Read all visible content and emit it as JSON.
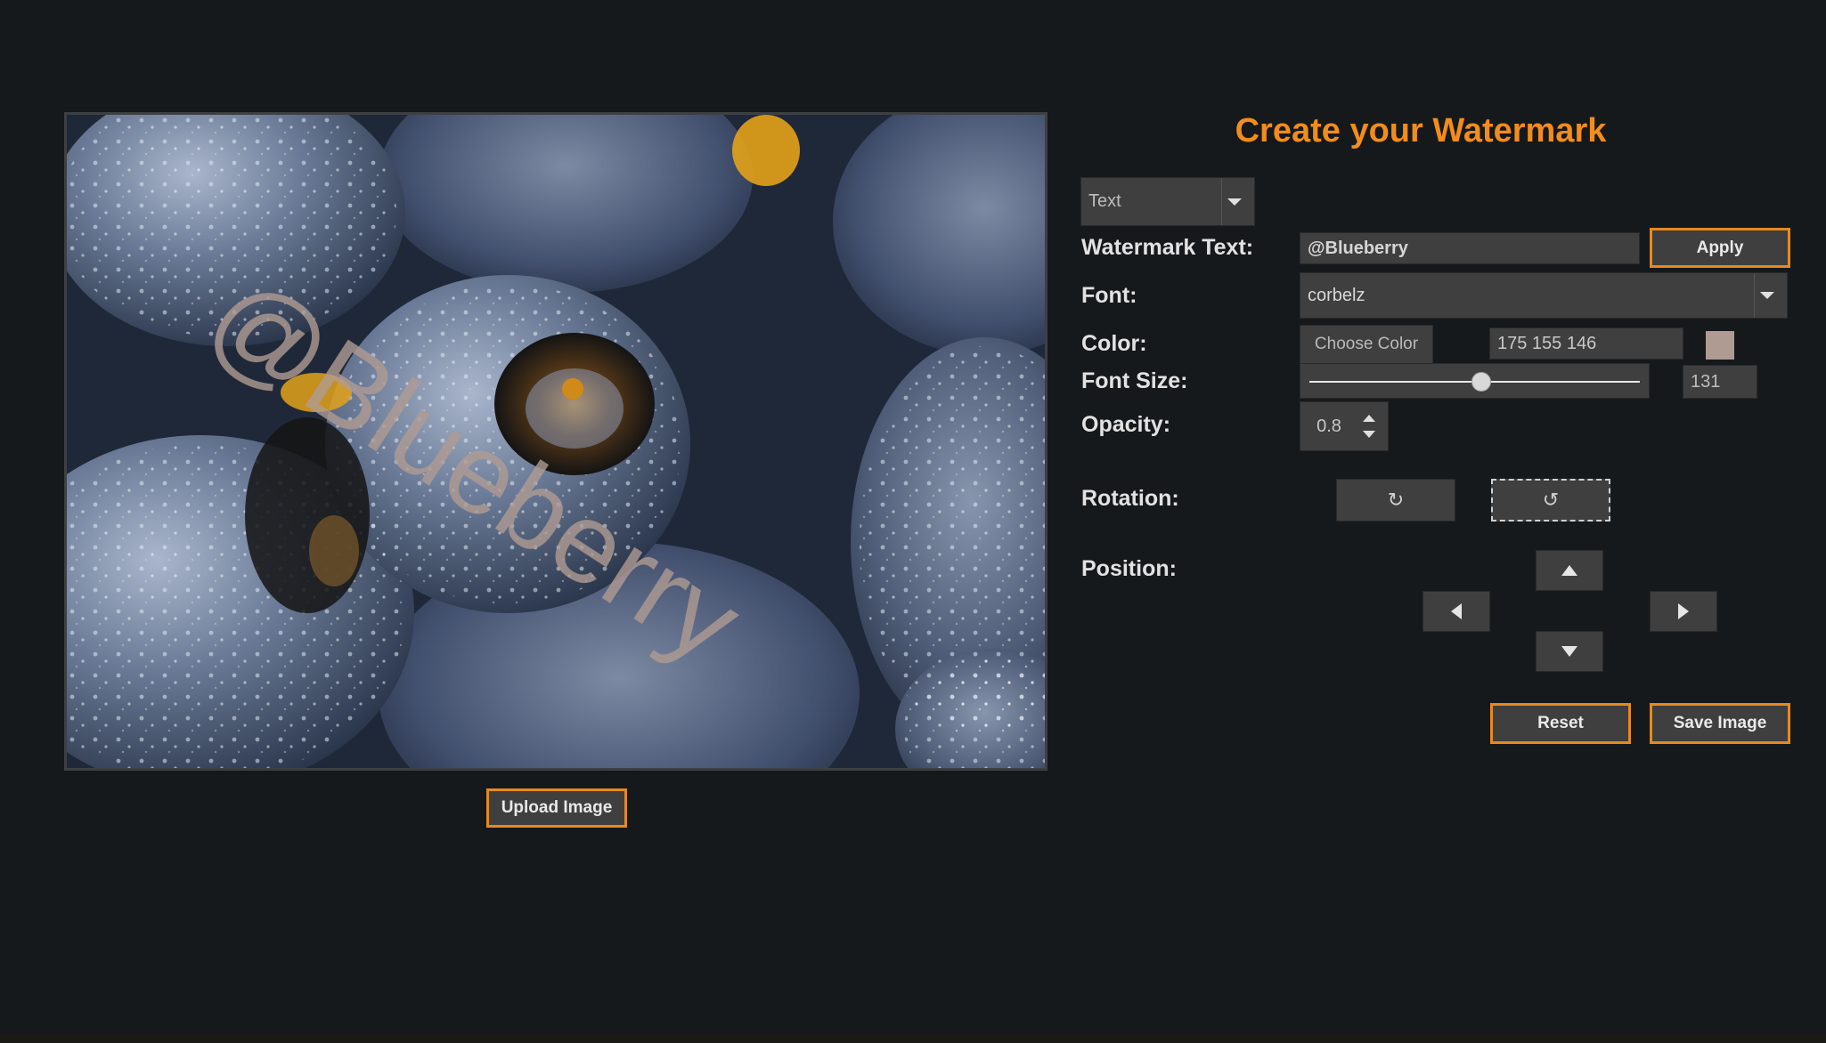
{
  "title": "Create your Watermark",
  "watermark_type": {
    "selected": "Text"
  },
  "labels": {
    "watermark_text": "Watermark Text:",
    "font": "Font:",
    "color": "Color:",
    "font_size": "Font Size:",
    "opacity": "Opacity:",
    "rotation": "Rotation:",
    "position": "Position:"
  },
  "watermark_text": {
    "value": "@Blueberry"
  },
  "font": {
    "selected": "corbelz"
  },
  "color": {
    "rgb_text": "175 155 146",
    "swatch_hex": "#af9b92"
  },
  "font_size": {
    "value": "131",
    "slider_fraction": 0.52
  },
  "opacity": {
    "value": "0.8"
  },
  "buttons": {
    "apply": "Apply",
    "choose_color": "Choose Color",
    "reset": "Reset",
    "save_image": "Save Image",
    "upload_image": "Upload Image"
  },
  "rotation_icons": {
    "clockwise": "↻",
    "counterclockwise": "↺"
  },
  "preview": {
    "overlay_text": "@Blueberry",
    "overlay_color": "#af9b92",
    "overlay_opacity": 0.8
  },
  "colors": {
    "accent": "#f28c1c",
    "button_border": "#e68a1f",
    "background": "#16191b"
  }
}
